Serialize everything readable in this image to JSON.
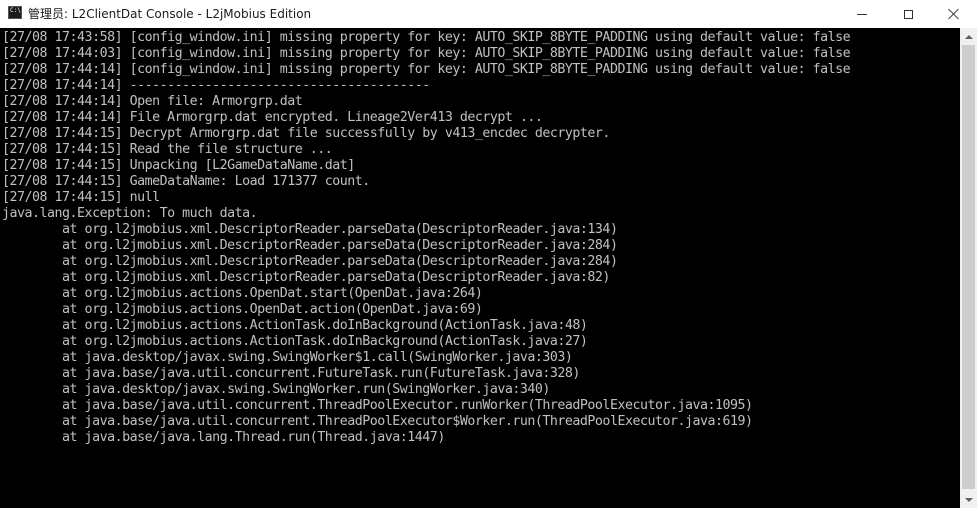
{
  "window": {
    "title_prefix": "管理员:",
    "title": "L2ClientDat Console - L2jMobius Edition",
    "app_icon_text": "C:\\"
  },
  "console": {
    "lines": [
      "[27/08 17:43:58] [config_window.ini] missing property for key: AUTO_SKIP_8BYTE_PADDING using default value: false",
      "[27/08 17:44:03] [config_window.ini] missing property for key: AUTO_SKIP_8BYTE_PADDING using default value: false",
      "[27/08 17:44:14] [config_window.ini] missing property for key: AUTO_SKIP_8BYTE_PADDING using default value: false",
      "[27/08 17:44:14] ----------------------------------------",
      "[27/08 17:44:14] Open file: Armorgrp.dat",
      "[27/08 17:44:14] File Armorgrp.dat encrypted. Lineage2Ver413 decrypt ...",
      "[27/08 17:44:15] Decrypt Armorgrp.dat file successfully by v413_encdec decrypter.",
      "[27/08 17:44:15] Read the file structure ...",
      "[27/08 17:44:15] Unpacking [L2GameDataName.dat]",
      "[27/08 17:44:15] GameDataName: Load 171377 count.",
      "[27/08 17:44:15] null",
      "java.lang.Exception: To much data.",
      "        at org.l2jmobius.xml.DescriptorReader.parseData(DescriptorReader.java:134)",
      "        at org.l2jmobius.xml.DescriptorReader.parseData(DescriptorReader.java:284)",
      "        at org.l2jmobius.xml.DescriptorReader.parseData(DescriptorReader.java:284)",
      "        at org.l2jmobius.xml.DescriptorReader.parseData(DescriptorReader.java:82)",
      "        at org.l2jmobius.actions.OpenDat.start(OpenDat.java:264)",
      "        at org.l2jmobius.actions.OpenDat.action(OpenDat.java:69)",
      "        at org.l2jmobius.actions.ActionTask.doInBackground(ActionTask.java:48)",
      "        at org.l2jmobius.actions.ActionTask.doInBackground(ActionTask.java:27)",
      "        at java.desktop/javax.swing.SwingWorker$1.call(SwingWorker.java:303)",
      "        at java.base/java.util.concurrent.FutureTask.run(FutureTask.java:328)",
      "        at java.desktop/javax.swing.SwingWorker.run(SwingWorker.java:340)",
      "        at java.base/java.util.concurrent.ThreadPoolExecutor.runWorker(ThreadPoolExecutor.java:1095)",
      "        at java.base/java.util.concurrent.ThreadPoolExecutor$Worker.run(ThreadPoolExecutor.java:619)",
      "        at java.base/java.lang.Thread.run(Thread.java:1447)"
    ]
  },
  "colors": {
    "console_background": "#000000",
    "console_text": "#c0c0c0",
    "titlebar_background": "#ffffff"
  },
  "icons": {
    "app": "console-app-icon",
    "minimize": "minimize-icon",
    "maximize": "maximize-icon",
    "close": "close-icon",
    "scroll_up": "scroll-up-arrow-icon",
    "scroll_down": "scroll-down-arrow-icon"
  }
}
